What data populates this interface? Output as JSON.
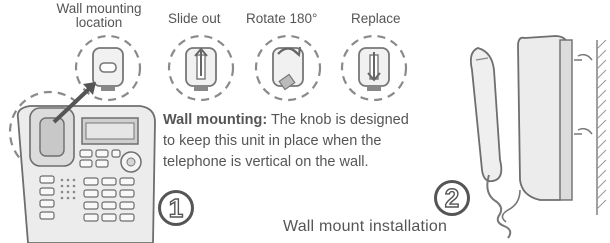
{
  "steps": [
    {
      "label": "Wall mounting location"
    },
    {
      "label": "Slide out"
    },
    {
      "label": "Rotate 180°"
    },
    {
      "label": "Replace"
    }
  ],
  "description": {
    "heading": "Wall mounting:",
    "line1": "The knob is designed",
    "line2": "to keep this unit in place when the",
    "line3": "telephone is vertical on the wall."
  },
  "badges": {
    "one": "1",
    "two": "2"
  },
  "caption": "Wall mount installation",
  "colors": {
    "line": "#6e6e6e",
    "fill": "#e9e9e9",
    "text": "#555555"
  }
}
